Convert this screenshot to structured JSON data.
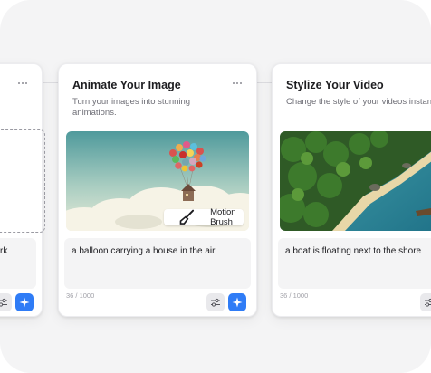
{
  "cards": [
    {
      "title": "",
      "description": "",
      "prompt": "a balloon carrying a house in the air",
      "prompt_visible_tail": "rk",
      "counter": ""
    },
    {
      "title": "Animate Your Image",
      "description": "Turn your images into stunning animations.",
      "prompt": "a balloon carrying a house in the air",
      "counter": "36 / 1000",
      "badge": {
        "label": "Motion Brush",
        "icon": "brush-icon"
      },
      "image": "hot air balloons lifting a house above clouds"
    },
    {
      "title": "Stylize Your Video",
      "description": "Change the style of your videos instantly.",
      "prompt": "a boat is floating next to the shore",
      "counter": "36 / 1000",
      "image": "aerial view of a tropical island shore with a boat"
    }
  ],
  "icons": {
    "more": "more-horizontal-icon",
    "settings": "sliders-icon",
    "magic": "sparkle-icon"
  },
  "colors": {
    "accent": "#2f7cf6",
    "canvas": "#f4f4f5",
    "card": "#ffffff"
  }
}
